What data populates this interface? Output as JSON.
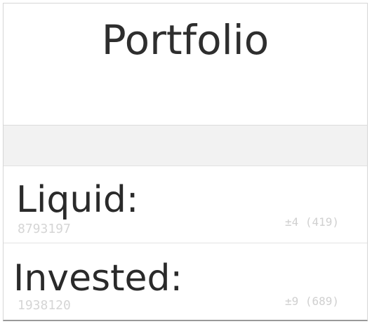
{
  "header": {
    "title": "Portfolio"
  },
  "accounts": [
    {
      "label": "Liquid:",
      "value": "8793197",
      "change": "±4 (419)"
    },
    {
      "label": "Invested:",
      "value": "1938120",
      "change": "±9 (689)"
    }
  ],
  "colors": {
    "background": "#ffffff",
    "band": "#f2f2f2",
    "text": "#2b2b2b",
    "muted": "#d5d5d5"
  }
}
